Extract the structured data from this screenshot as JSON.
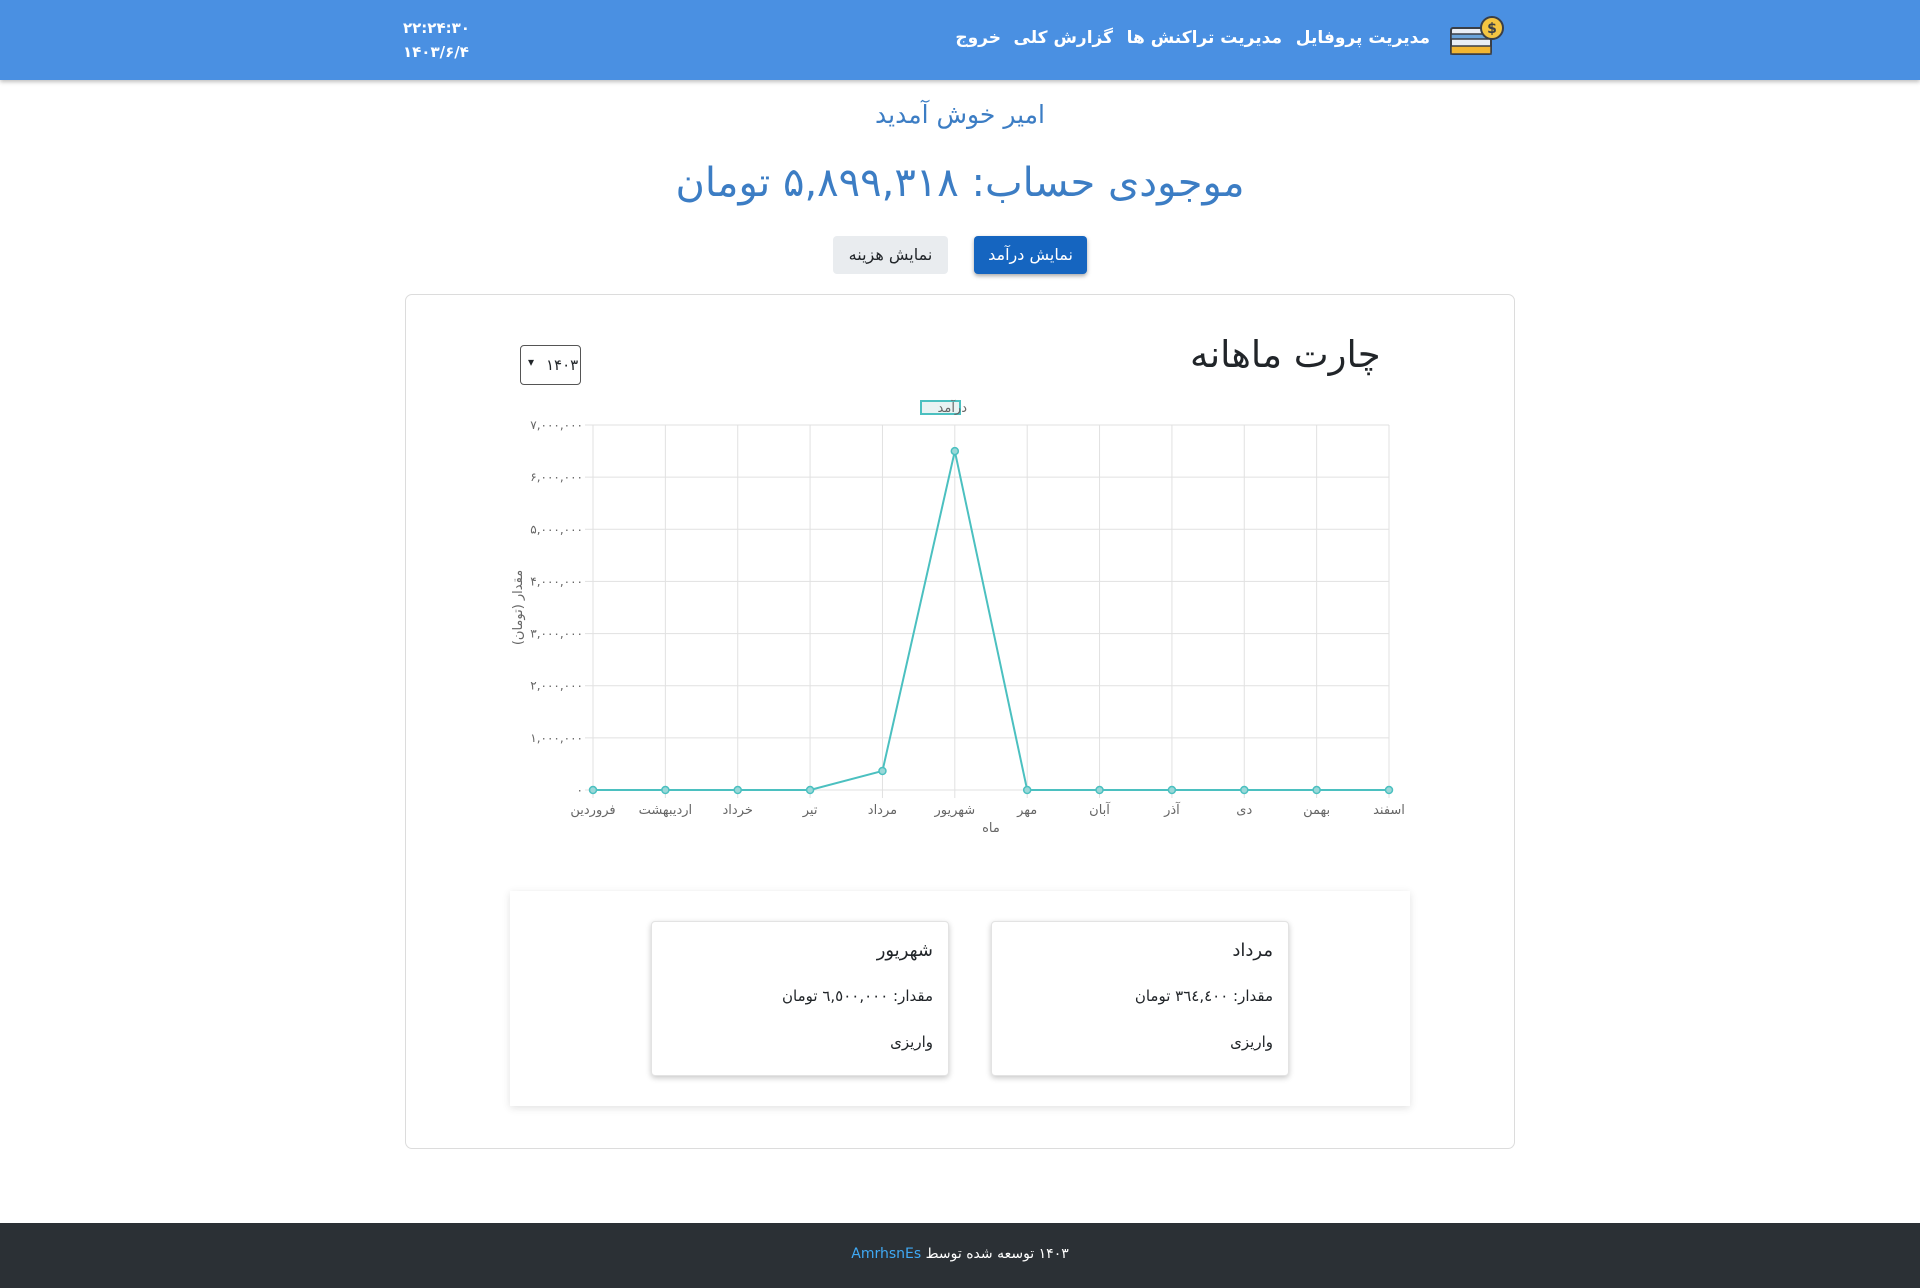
{
  "nav": {
    "logo_icon": "wallet-coin-icon",
    "profile": "مدیریت پروفایل",
    "transactions": "مدیریت تراکنش ها",
    "report": "گزارش کلی",
    "logout": "خروج",
    "time": "۲۲:۲۴:۳۰",
    "date": "۱۴۰۳/۶/۴"
  },
  "welcome": "امیر خوش آمدید",
  "balance": "موجودی حساب: ۵,۸۹۹,۳۱۸ تومان",
  "buttons": {
    "income": "نمایش درآمد",
    "expense": "نمایش هزینه"
  },
  "chart_section": {
    "title": "چارت ماهانه",
    "year": "۱۴۰۳"
  },
  "chart_data": {
    "type": "line",
    "categories": [
      "فروردین",
      "اردیبهشت",
      "خرداد",
      "تیر",
      "مرداد",
      "شهریور",
      "مهر",
      "آبان",
      "آذر",
      "دی",
      "بهمن",
      "اسفند"
    ],
    "series": [
      {
        "name": "درآمد",
        "values": [
          0,
          0,
          0,
          0,
          364400,
          6500000,
          0,
          0,
          0,
          0,
          0,
          0
        ],
        "color": "#4bc0c0"
      }
    ],
    "xlabel": "ماه",
    "ylabel": "مقدار (تومان)",
    "ylim": [
      0,
      7000000
    ],
    "yticks": [
      0,
      1000000,
      2000000,
      3000000,
      4000000,
      5000000,
      6000000,
      7000000
    ],
    "ytick_labels": [
      "۰",
      "۱,۰۰۰,۰۰۰",
      "۲,۰۰۰,۰۰۰",
      "۳,۰۰۰,۰۰۰",
      "۴,۰۰۰,۰۰۰",
      "۵,۰۰۰,۰۰۰",
      "۶,۰۰۰,۰۰۰",
      "۷,۰۰۰,۰۰۰"
    ],
    "grid": true,
    "legend": "top"
  },
  "month_cards": [
    {
      "title": "مرداد",
      "amount": "مقدار: ۳٦٤,٤۰۰ تومان",
      "type": "واریزی"
    },
    {
      "title": "شهریور",
      "amount": "مقدار: ٦,٥۰۰,۰۰۰ تومان",
      "type": "واریزی"
    }
  ],
  "footer": {
    "text": "۱۴۰۳ توسعه شده توسط",
    "author": "AmrhsnEs"
  }
}
